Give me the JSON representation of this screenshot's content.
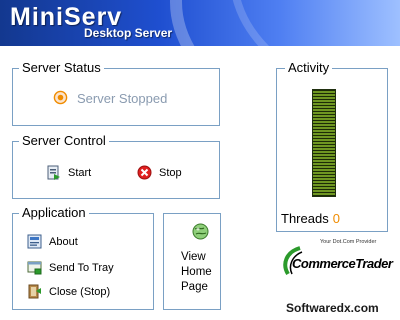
{
  "header": {
    "title": "MiniServ",
    "subtitle": "Desktop Server"
  },
  "status": {
    "legend": "Server Status",
    "text": "Server Stopped"
  },
  "control": {
    "legend": "Server Control",
    "start": "Start",
    "stop": "Stop"
  },
  "application": {
    "legend": "Application",
    "about": "About",
    "send_to_tray": "Send To Tray",
    "close": "Close (Stop)"
  },
  "view": {
    "label": "View\nHome\nPage"
  },
  "activity": {
    "legend": "Activity",
    "threads_label": "Threads",
    "threads_count": "0",
    "level": 1.0
  },
  "logo": {
    "tagline": "Your Dot.Com Provider",
    "name": "CommerceTrader"
  },
  "footer": {
    "website": "Softwaredx.com"
  },
  "colors": {
    "accent_orange": "#f08c00",
    "status_gray": "#8a9bb0",
    "border": "#7aa0c4",
    "meter_green": "#6f9722"
  },
  "icons": {
    "status": "stopped-status-icon",
    "start": "start-icon",
    "stop": "stop-icon",
    "about": "about-icon",
    "tray": "tray-icon",
    "close": "close-icon",
    "view": "globe-icon"
  }
}
